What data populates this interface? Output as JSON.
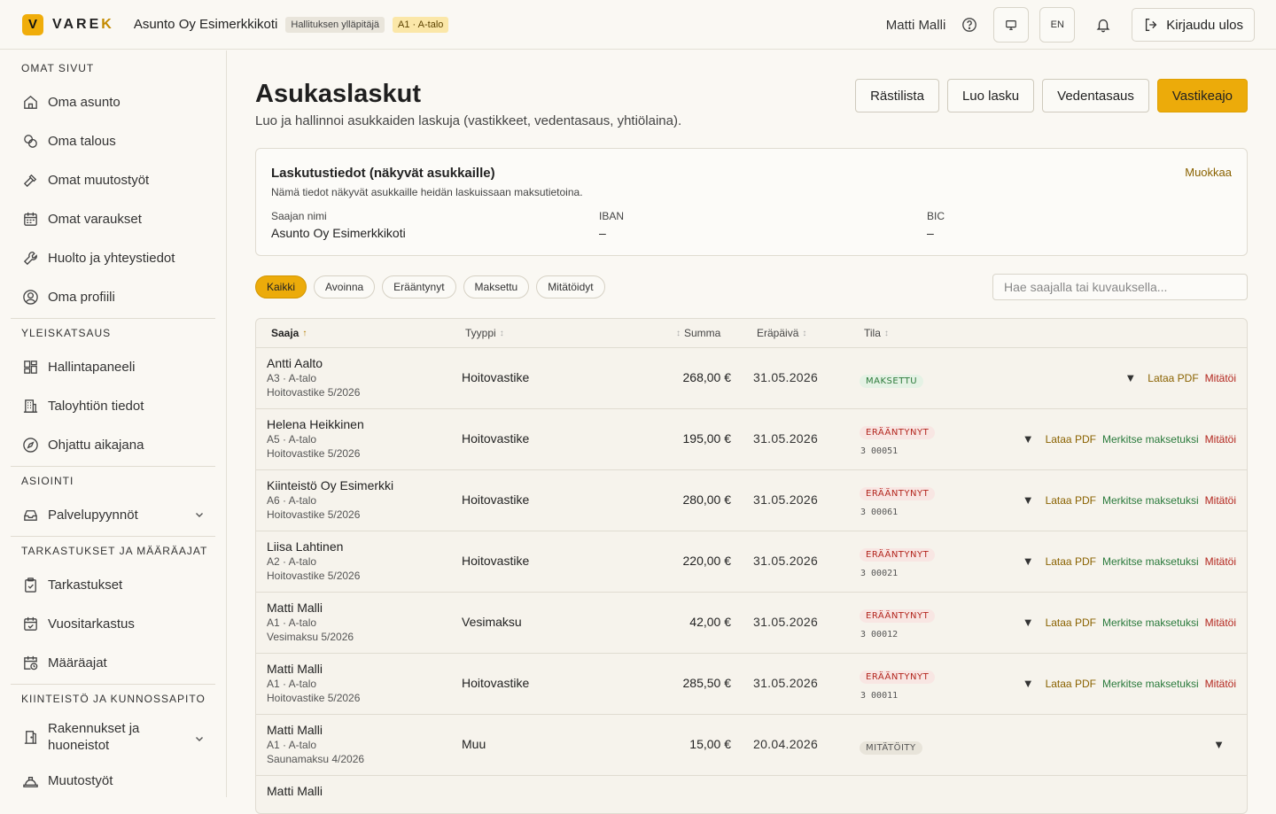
{
  "header": {
    "logo_letter": "V",
    "logo_text_a": "VARE",
    "logo_text_b": "K",
    "org_name": "Asunto Oy Esimerkkikoti",
    "role_badge": "Hallituksen ylläpitäjä",
    "unit_badge": "A1 · A-talo",
    "user_name": "Matti Malli",
    "language": "EN",
    "logout_label": "Kirjaudu ulos",
    "accent_color": "#ecab0a"
  },
  "sidebar": {
    "sections": [
      {
        "title": "OMAT SIVUT",
        "items": [
          {
            "label": "Oma asunto",
            "icon": "home-icon"
          },
          {
            "label": "Oma talous",
            "icon": "coins-icon"
          },
          {
            "label": "Omat muutostyöt",
            "icon": "hammer-icon"
          },
          {
            "label": "Omat varaukset",
            "icon": "calendar-icon"
          },
          {
            "label": "Huolto ja yhteystiedot",
            "icon": "wrench-icon"
          },
          {
            "label": "Oma profiili",
            "icon": "user-circle-icon"
          }
        ]
      },
      {
        "title": "YLEISKATSAUS",
        "items": [
          {
            "label": "Hallintapaneeli",
            "icon": "dashboard-icon"
          },
          {
            "label": "Taloyhtiön tiedot",
            "icon": "building-icon"
          },
          {
            "label": "Ohjattu aikajana",
            "icon": "compass-icon"
          }
        ]
      },
      {
        "title": "ASIOINTI",
        "items": [
          {
            "label": "Palvelupyynnöt",
            "icon": "inbox-icon"
          }
        ]
      },
      {
        "title": "TARKASTUKSET JA MÄÄRÄAJAT",
        "items": [
          {
            "label": "Tarkastukset",
            "icon": "clipboard-check-icon"
          },
          {
            "label": "Vuositarkastus",
            "icon": "calendar-check-icon"
          },
          {
            "label": "Määräajat",
            "icon": "calendar-clock-icon"
          }
        ]
      },
      {
        "title": "KIINTEISTÖ JA KUNNOSSAPITO",
        "items": [
          {
            "label_line1": "Rakennukset ja",
            "label_line2": "huoneistot",
            "icon": "door-icon"
          },
          {
            "label": "Muutostyöt",
            "icon": "hard-hat-icon"
          }
        ]
      }
    ]
  },
  "main": {
    "title": "Asukaslaskut",
    "subtitle": "Luo ja hallinnoi asukkaiden laskuja (vastikkeet, vedentasaus, yhtiölaina).",
    "actions": [
      "Rästilista",
      "Luo lasku",
      "Vedentasaus",
      "Vastikeajo"
    ],
    "billing_info": {
      "title": "Laskutustiedot (näkyvät asukkaille)",
      "edit_label": "Muokkaa",
      "description": "Nämä tiedot näkyvät asukkaille heidän laskuissaan maksutietoina.",
      "recipient_label": "Saajan nimi",
      "recipient_value": "Asunto Oy Esimerkkikoti",
      "iban_label": "IBAN",
      "iban_value": "–",
      "bic_label": "BIC",
      "bic_value": "–"
    },
    "filters": [
      "Kaikki",
      "Avoinna",
      "Erääntynyt",
      "Maksettu",
      "Mitätöidyt"
    ],
    "active_filter": "Kaikki",
    "search_placeholder": "Hae saajalla tai kuvauksella...",
    "table": {
      "columns": {
        "recipient": "Saaja",
        "type": "Tyyppi",
        "amount": "Summa",
        "due_date": "Eräpäivä",
        "status": "Tila"
      },
      "actions": {
        "pdf": "Lataa PDF",
        "mark_paid": "Merkitse maksetuksi",
        "void": "Mitätöi"
      },
      "rows": [
        {
          "name": "Antti Aalto",
          "unit": "A3 · A-talo",
          "desc": "Hoitovastike 5/2026",
          "type": "Hoitovastike",
          "amount": "268,00 €",
          "due": "31.05.2026",
          "status": "MAKSETTU",
          "status_kind": "paid",
          "ref": ""
        },
        {
          "name": "Helena Heikkinen",
          "unit": "A5 · A-talo",
          "desc": "Hoitovastike 5/2026",
          "type": "Hoitovastike",
          "amount": "195,00 €",
          "due": "31.05.2026",
          "status": "ERÄÄNTYNYT",
          "status_kind": "due",
          "ref": "3 00051"
        },
        {
          "name": "Kiinteistö Oy Esimerkki",
          "unit": "A6 · A-talo",
          "desc": "Hoitovastike 5/2026",
          "type": "Hoitovastike",
          "amount": "280,00 €",
          "due": "31.05.2026",
          "status": "ERÄÄNTYNYT",
          "status_kind": "due",
          "ref": "3 00061"
        },
        {
          "name": "Liisa Lahtinen",
          "unit": "A2 · A-talo",
          "desc": "Hoitovastike 5/2026",
          "type": "Hoitovastike",
          "amount": "220,00 €",
          "due": "31.05.2026",
          "status": "ERÄÄNTYNYT",
          "status_kind": "due",
          "ref": "3 00021"
        },
        {
          "name": "Matti Malli",
          "unit": "A1 · A-talo",
          "desc": "Vesimaksu 5/2026",
          "type": "Vesimaksu",
          "amount": "42,00 €",
          "due": "31.05.2026",
          "status": "ERÄÄNTYNYT",
          "status_kind": "due",
          "ref": "3 00012"
        },
        {
          "name": "Matti Malli",
          "unit": "A1 · A-talo",
          "desc": "Hoitovastike 5/2026",
          "type": "Hoitovastike",
          "amount": "285,50 €",
          "due": "31.05.2026",
          "status": "ERÄÄNTYNYT",
          "status_kind": "due",
          "ref": "3 00011"
        },
        {
          "name": "Matti Malli",
          "unit": "A1 · A-talo",
          "desc": "Saunamaksu 4/2026",
          "type": "Muu",
          "amount": "15,00 €",
          "due": "20.04.2026",
          "status": "MITÄTÖITY",
          "status_kind": "void",
          "ref": ""
        },
        {
          "name": "Matti Malli",
          "unit": "",
          "desc": "",
          "type": "",
          "amount": "",
          "due": "",
          "status": "",
          "status_kind": "",
          "ref": ""
        }
      ]
    }
  }
}
